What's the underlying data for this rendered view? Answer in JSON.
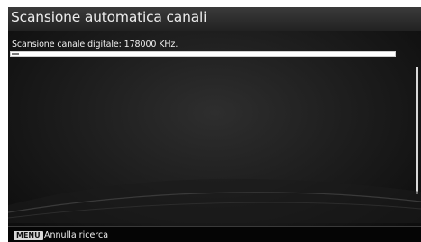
{
  "title": "Scansione automatica canali",
  "status": {
    "label": "Scansione canale digitale:",
    "frequency": "178000 KHz."
  },
  "progress": {
    "fraction": 0.02
  },
  "footer": {
    "key_label": "MENU",
    "action_label": "Annulla ricerca"
  }
}
